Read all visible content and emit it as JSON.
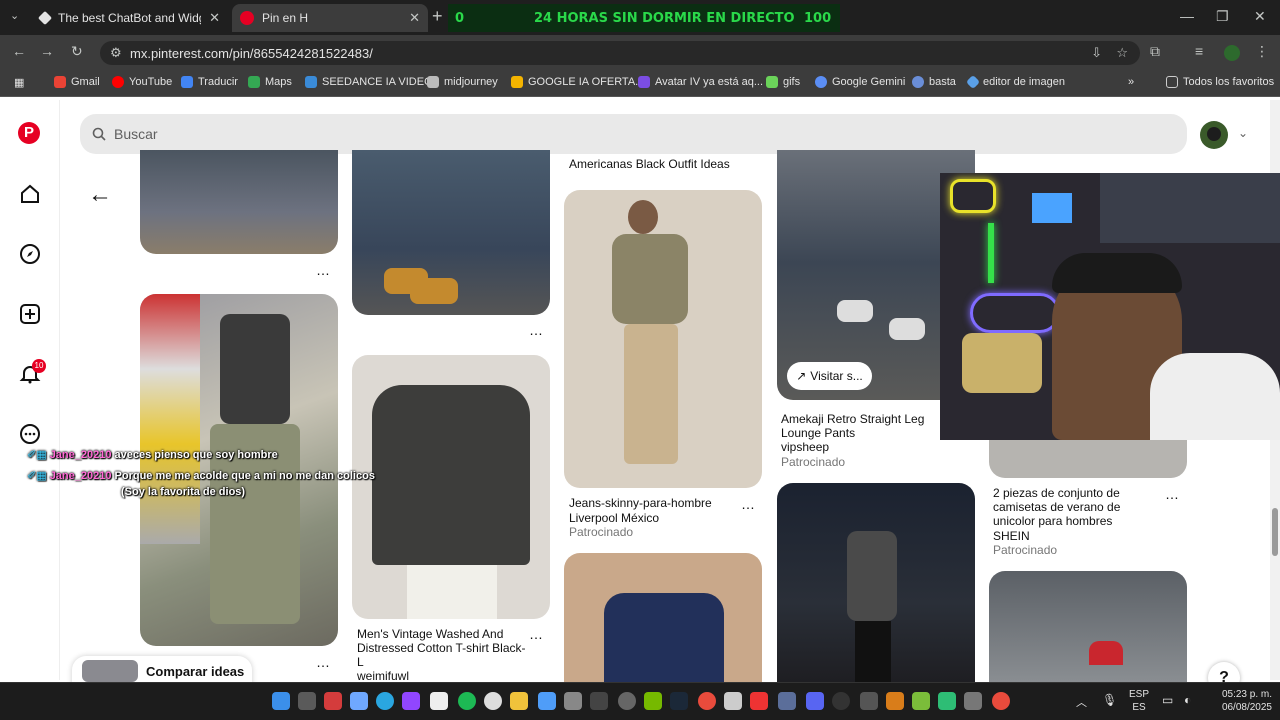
{
  "browser": {
    "tabs": [
      {
        "title": "The best ChatBot and Widgets",
        "favicon_color": "#e3e3e3"
      },
      {
        "title": "Pin en H",
        "favicon_color": "#e60023"
      }
    ],
    "stream_banner": {
      "left": "0",
      "center": "24 HORAS SIN DORMIR EN DIRECTO",
      "right": "100"
    },
    "url": "mx.pinterest.com/pin/8655424281522483/",
    "bookmarks": [
      "Gmail",
      "YouTube",
      "Traducir",
      "Maps",
      "SEEDANCE IA VIDEO",
      "midjourney",
      "GOOGLE IA OFERTA...",
      "Avatar IV ya está aq...",
      "gifs",
      "Google Gemini",
      "basta",
      "editor de imagen"
    ],
    "all_bookmarks": "Todos los favoritos"
  },
  "pinterest": {
    "brand_color": "#e60023",
    "search_placeholder": "Buscar",
    "notifications_count": "10",
    "pins": [
      {
        "title": "Amekaji Retro Straight Leg Lounge Pants",
        "source": "vipsheep",
        "sponsored": "Patrocinado"
      },
      {
        "title": "Jeans-skinny-para-hombre",
        "source": "Liverpool México",
        "sponsored": "Patrocinado"
      },
      {
        "title": "Men's Vintage Washed And Distressed Cotton T-shirt Black-L",
        "source": "weimifuwl"
      },
      {
        "title": "2 piezas de conjunto de camisetas de verano de unicolor para hombres",
        "source": "SHEIN",
        "sponsored": "Patrocinado"
      }
    ],
    "visit_button": "Visitar s...",
    "top_cut_text": "Americanas Black Outfit Ideas",
    "compare_label": "Comparar ideas",
    "help": "?"
  },
  "chat": [
    {
      "user": "Jane_20210",
      "message": "aveces pienso que soy hombre"
    },
    {
      "user": "Jane_20210",
      "message": "Porque me me acolde que a mi no me dan colicos"
    },
    {
      "user": "",
      "message": "(Soy la favorita de dios)"
    }
  ],
  "taskbar": {
    "lang": "ESP",
    "region": "ES",
    "time": "05:23 p. m.",
    "date": "06/08/2025"
  }
}
